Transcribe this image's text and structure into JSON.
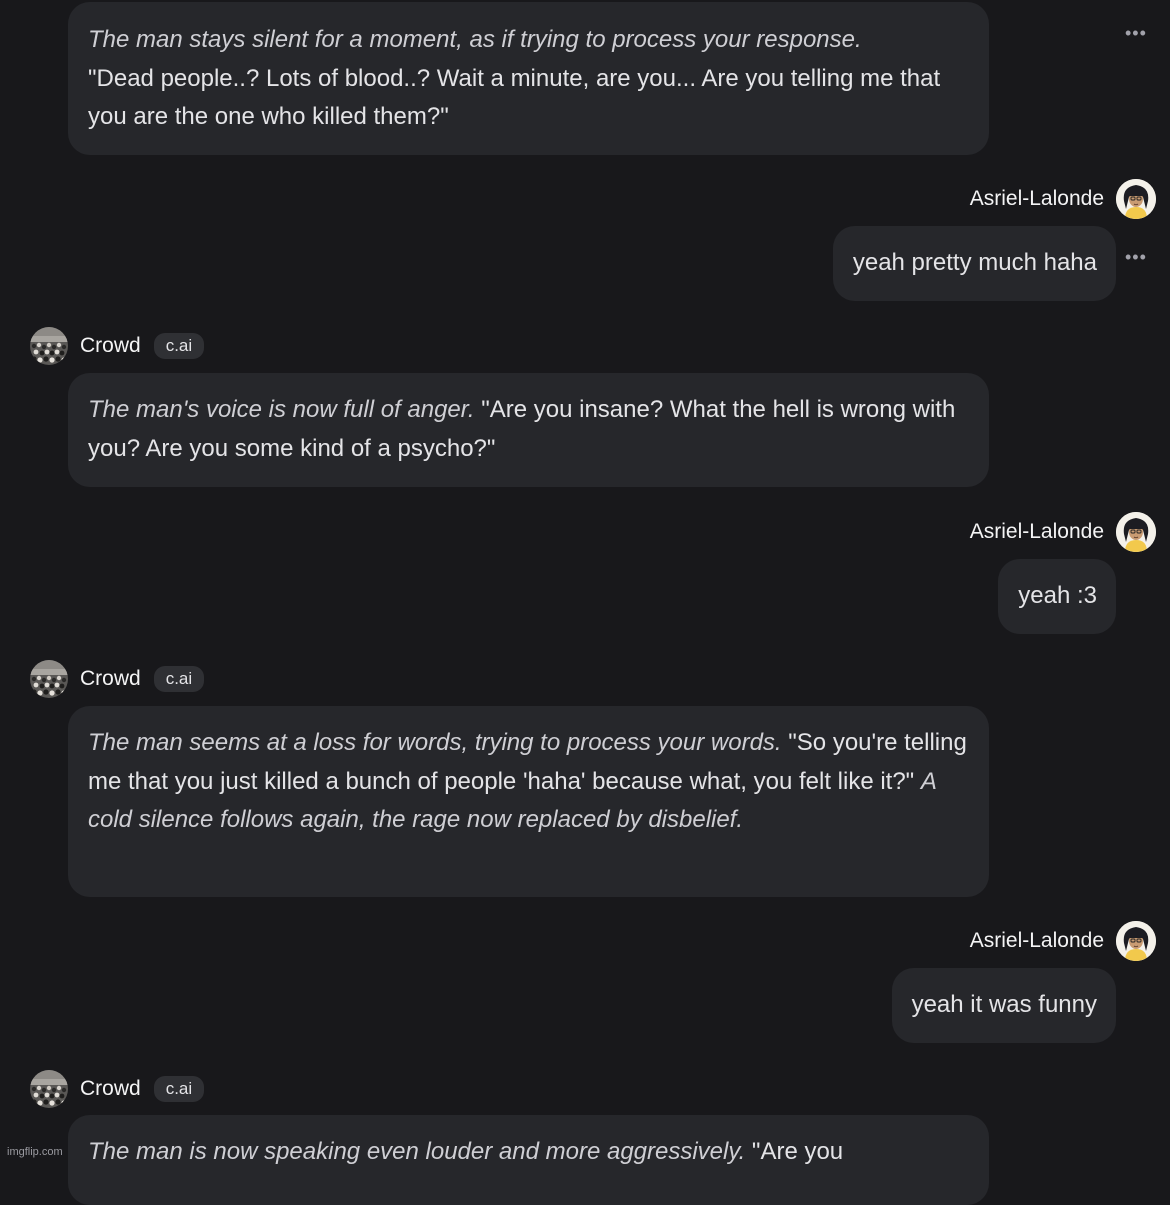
{
  "user": {
    "name": "Asriel-Lalonde"
  },
  "bot": {
    "name": "Crowd",
    "badge": "c.ai"
  },
  "messages": [
    {
      "italic": "The man stays silent for a moment, as if trying to process your response.",
      "text": "\"Dead people..? Lots of blood..? Wait a minute, are you... Are you telling me that you are the one who killed them?\""
    },
    {
      "text": "yeah pretty much haha"
    },
    {
      "italic": "The man's voice is now full of anger.",
      "text": "\"Are you insane? What the hell is wrong with you? Are you some kind of a psycho?\""
    },
    {
      "text": "yeah :3"
    },
    {
      "italic": "The man seems at a loss for words, trying to process your words.",
      "text": "\"So you're telling me that you just killed a bunch of people 'haha' because what, you felt like it?\"",
      "italic2": "A cold silence follows again, the rage now replaced by disbelief."
    },
    {
      "text": "yeah it was funny"
    },
    {
      "italic": "The man is now speaking even louder and more aggressively.",
      "text": "\"Are you"
    }
  ],
  "ui": {
    "menu_dots": "•••"
  },
  "watermark": "imgflip.com",
  "icons": {
    "menu": "more-dots-icon",
    "crowd_avatar": "crowd-avatar",
    "user_avatar": "user-avatar"
  },
  "colors": {
    "background": "#18181b",
    "bubble": "#26272b",
    "text": "#e4e4e7",
    "badge_bg": "#2f3034"
  }
}
